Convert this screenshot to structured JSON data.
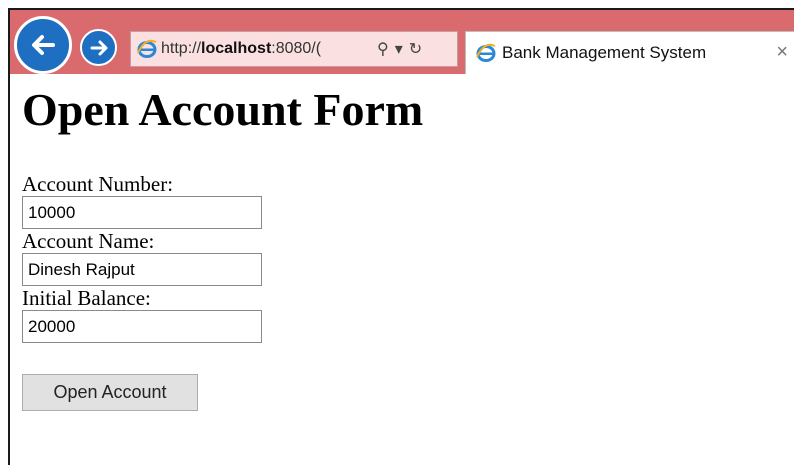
{
  "browser": {
    "url_prefix": "http://",
    "url_host": "localhost",
    "url_rest": ":8080/(",
    "tab_title": "Bank Management System",
    "tab_close": "×",
    "search_glyph": "⚲",
    "dropdown_glyph": "▾",
    "refresh_glyph": "↻"
  },
  "page": {
    "title": "Open Account Form"
  },
  "form": {
    "account_number_label": "Account Number:",
    "account_number_value": "10000",
    "account_name_label": "Account Name:",
    "account_name_value": "Dinesh Rajput",
    "initial_balance_label": "Initial Balance:",
    "initial_balance_value": "20000",
    "submit_label": "Open Account"
  },
  "colors": {
    "chrome": "#d96b6f",
    "nav_button": "#1e6fc2"
  }
}
